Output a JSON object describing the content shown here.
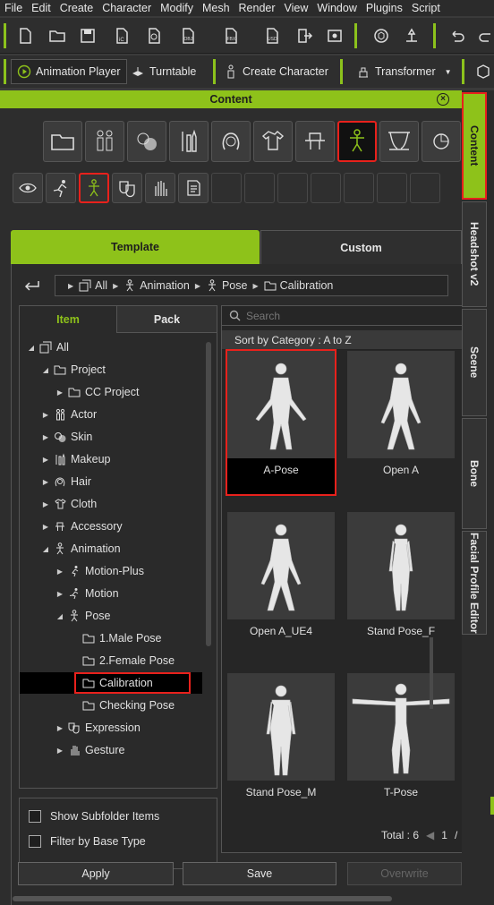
{
  "menu": [
    "File",
    "Edit",
    "Create",
    "Character",
    "Modify",
    "Mesh",
    "Render",
    "View",
    "Window",
    "Plugins",
    "Script"
  ],
  "toolbar2": {
    "animation_player": "Animation Player",
    "turntable": "Turntable",
    "create_character": "Create Character",
    "transformer": "Transformer"
  },
  "content_header": {
    "title": "Content"
  },
  "tabs": {
    "template": "Template",
    "custom": "Custom"
  },
  "breadcrumb": [
    "All",
    "Animation",
    "Pose",
    "Calibration"
  ],
  "tree_tabs": {
    "item": "Item",
    "pack": "Pack"
  },
  "tree": [
    {
      "label": "All",
      "level": 0,
      "toggle": "open",
      "icon": "all-icon"
    },
    {
      "label": "Project",
      "level": 1,
      "toggle": "open",
      "icon": "folder-icon"
    },
    {
      "label": "CC Project",
      "level": 2,
      "toggle": "closed",
      "icon": "folder-icon"
    },
    {
      "label": "Actor",
      "level": 1,
      "toggle": "closed",
      "icon": "actor-icon"
    },
    {
      "label": "Skin",
      "level": 1,
      "toggle": "closed",
      "icon": "skin-icon"
    },
    {
      "label": "Makeup",
      "level": 1,
      "toggle": "closed",
      "icon": "makeup-icon"
    },
    {
      "label": "Hair",
      "level": 1,
      "toggle": "closed",
      "icon": "hair-icon"
    },
    {
      "label": "Cloth",
      "level": 1,
      "toggle": "closed",
      "icon": "cloth-icon"
    },
    {
      "label": "Accessory",
      "level": 1,
      "toggle": "closed",
      "icon": "accessory-icon"
    },
    {
      "label": "Animation",
      "level": 1,
      "toggle": "open",
      "icon": "animation-icon"
    },
    {
      "label": "Motion-Plus",
      "level": 2,
      "toggle": "closed",
      "icon": "motion-plus-icon"
    },
    {
      "label": "Motion",
      "level": 2,
      "toggle": "closed",
      "icon": "motion-icon"
    },
    {
      "label": "Pose",
      "level": 2,
      "toggle": "open",
      "icon": "pose-icon"
    },
    {
      "label": "1.Male Pose",
      "level": 3,
      "toggle": "",
      "icon": "folder-icon"
    },
    {
      "label": "2.Female Pose",
      "level": 3,
      "toggle": "",
      "icon": "folder-icon"
    },
    {
      "label": "Calibration",
      "level": 3,
      "toggle": "",
      "icon": "folder-icon",
      "selected": true
    },
    {
      "label": "Checking Pose",
      "level": 3,
      "toggle": "",
      "icon": "folder-icon"
    },
    {
      "label": "Expression",
      "level": 2,
      "toggle": "closed",
      "icon": "expression-icon"
    },
    {
      "label": "Gesture",
      "level": 2,
      "toggle": "closed",
      "icon": "gesture-icon"
    }
  ],
  "options": {
    "show_subfolder": "Show Subfolder Items",
    "filter_base_type": "Filter by Base Type"
  },
  "search": {
    "placeholder": "Search"
  },
  "sort": {
    "label": "Sort by Category : A to Z"
  },
  "items": [
    {
      "label": "A-Pose",
      "pose": "a-pose",
      "selected": true
    },
    {
      "label": "Open A",
      "pose": "open-a"
    },
    {
      "label": "Open A_UE4",
      "pose": "open-a"
    },
    {
      "label": "Stand Pose_F",
      "pose": "stand-f"
    },
    {
      "label": "Stand Pose_M",
      "pose": "stand-m"
    },
    {
      "label": "T-Pose",
      "pose": "t-pose"
    }
  ],
  "pager": {
    "total": "Total : 6",
    "page": "1",
    "sep": "/"
  },
  "buttons": {
    "apply": "Apply",
    "save": "Save",
    "overwrite": "Overwrite"
  },
  "side_tabs": [
    "Content",
    "Headshot v2",
    "Scene",
    "Bone",
    "Facial Profile Editor"
  ],
  "colors": {
    "accent": "#8ec21a",
    "highlight": "#e8211c"
  }
}
